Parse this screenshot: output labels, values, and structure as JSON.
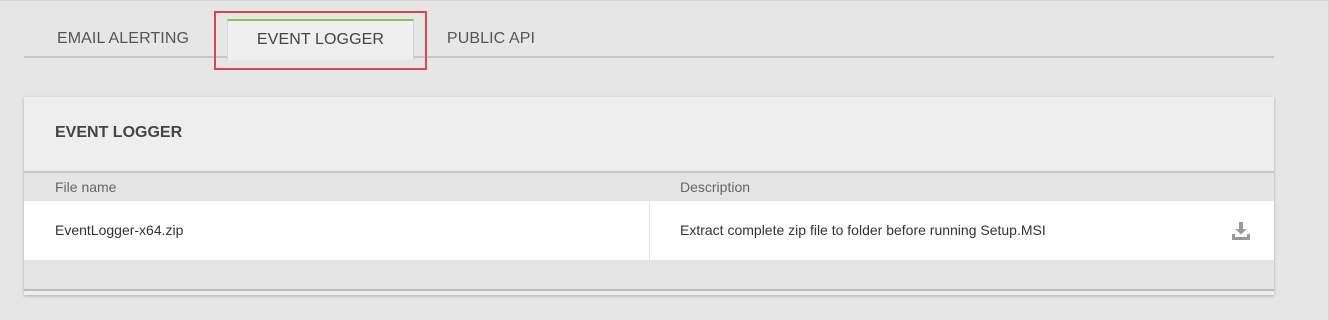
{
  "tabs": [
    {
      "label": "EMAIL ALERTING"
    },
    {
      "label": "EVENT LOGGER"
    },
    {
      "label": "PUBLIC API"
    }
  ],
  "active_tab": "EVENT LOGGER",
  "panel": {
    "title": "EVENT LOGGER",
    "columns": [
      "File name",
      "Description"
    ],
    "rows": [
      {
        "file": "EventLogger-x64.zip",
        "description": "Extract complete zip file to folder before running Setup.MSI",
        "action_icon": "download-icon"
      }
    ]
  },
  "colors": {
    "active_tab_accent": "#8cc152",
    "highlight": "#e0454b"
  }
}
